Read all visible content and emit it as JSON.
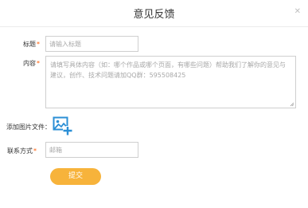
{
  "dialog": {
    "title": "意见反馈",
    "close_icon": "close-icon"
  },
  "form": {
    "title_label": "标题",
    "title_placeholder": "请输入标题",
    "content_label": "内容",
    "content_placeholder": "请填写具体内容（如：哪个作品或哪个页面，有哪些问题）帮助我们了解你的意见与建议，创作、技术问题请加QQ群：595508425",
    "image_label": "添加图片文件：",
    "image_icon": "add-image-icon",
    "contact_label": "联系方式",
    "contact_placeholder": "邮箱",
    "required_mark": "*",
    "submit_label": "提交"
  },
  "colors": {
    "required": "#ff5a00",
    "submit_bg": "#f7b33b",
    "upload_icon": "#2b8fd6"
  }
}
